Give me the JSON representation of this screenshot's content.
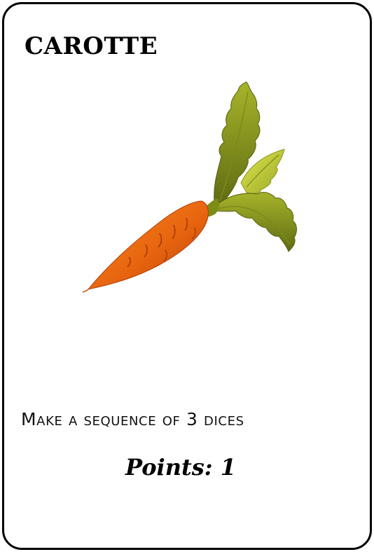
{
  "card": {
    "title": "CAROTTE",
    "objective": "Make a sequence of 3 dices",
    "points_label": "Points: 1",
    "illustration": "carrot",
    "colors": {
      "border": "#000000",
      "background": "#ffffff",
      "carrot_orange": "#e8650f",
      "leaf_green": "#8a9a1e",
      "leaf_light": "#c8d43a"
    }
  }
}
